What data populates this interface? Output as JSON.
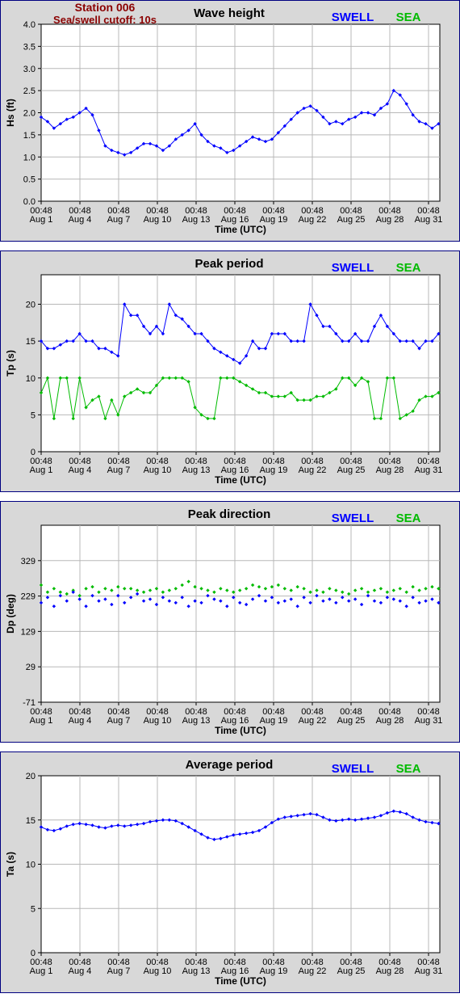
{
  "station": {
    "name": "Station 006",
    "cutoff": "Sea/swell cutoff: 10s"
  },
  "legend": {
    "swell": "SWELL",
    "sea": "SEA"
  },
  "colors": {
    "swell": "#0000ff",
    "sea": "#00bb00",
    "panel_bg": "#d8d8d8",
    "border": "#000080",
    "station": "#8b0000"
  },
  "x_ticks": {
    "time": [
      "00:48",
      "00:48",
      "00:48",
      "00:48",
      "00:48",
      "00:48",
      "00:48",
      "00:48",
      "00:48",
      "00:48",
      "00:48"
    ],
    "date": [
      "Aug 1",
      "Aug 4",
      "Aug 7",
      "Aug 10",
      "Aug 13",
      "Aug 16",
      "Aug 19",
      "Aug 22",
      "Aug 25",
      "Aug 28",
      "Aug 31"
    ]
  },
  "chart_data": [
    {
      "type": "line",
      "title": "Wave height",
      "xlabel": "Time (UTC)",
      "ylabel": "Hs (ft)",
      "ylim": [
        0,
        4
      ],
      "yticks": [
        "0.0",
        "0.5",
        "1.0",
        "1.5",
        "2.0",
        "2.5",
        "3.0",
        "3.5",
        "4.0"
      ],
      "xlim": [
        1,
        32.1
      ],
      "grid": true,
      "series": [
        {
          "name": "SWELL",
          "color": "#0000ff",
          "x": [
            1.0,
            1.5,
            2.0,
            2.5,
            3.0,
            3.5,
            4.0,
            4.5,
            5.0,
            5.5,
            6.0,
            6.5,
            7.0,
            7.5,
            8.0,
            8.5,
            9.0,
            9.5,
            10.0,
            10.5,
            11.0,
            11.5,
            12.0,
            12.5,
            13.0,
            13.5,
            14.0,
            14.5,
            15.0,
            15.5,
            16.0,
            16.5,
            17.0,
            17.5,
            18.0,
            18.5,
            19.0,
            19.5,
            20.0,
            20.5,
            21.0,
            21.5,
            22.0,
            22.5,
            23.0,
            23.5,
            24.0,
            24.5,
            25.0,
            25.5,
            26.0,
            26.5,
            27.0,
            27.5,
            28.0,
            28.5,
            29.0,
            29.5,
            30.0,
            30.5,
            31.0,
            31.5,
            32.0
          ],
          "y": [
            1.9,
            1.8,
            1.65,
            1.75,
            1.85,
            1.9,
            2.0,
            2.1,
            1.95,
            1.6,
            1.25,
            1.15,
            1.1,
            1.05,
            1.1,
            1.2,
            1.3,
            1.3,
            1.25,
            1.15,
            1.25,
            1.4,
            1.5,
            1.6,
            1.75,
            1.5,
            1.35,
            1.25,
            1.2,
            1.1,
            1.15,
            1.25,
            1.35,
            1.45,
            1.4,
            1.35,
            1.4,
            1.55,
            1.7,
            1.85,
            2.0,
            2.1,
            2.15,
            2.05,
            1.9,
            1.75,
            1.8,
            1.75,
            1.85,
            1.9,
            2.0,
            2.0,
            1.95,
            2.1,
            2.2,
            2.5,
            2.4,
            2.2,
            1.95,
            1.8,
            1.75,
            1.65,
            1.75
          ]
        },
        {
          "name": "SEA",
          "color": "#00bb00",
          "x": [],
          "y": []
        }
      ]
    },
    {
      "type": "line",
      "title": "Peak period",
      "xlabel": "Time (UTC)",
      "ylabel": "Tp (s)",
      "ylim": [
        0,
        24
      ],
      "yticks": [
        "0",
        "5",
        "10",
        "15",
        "20"
      ],
      "xlim": [
        1,
        32.1
      ],
      "grid": true,
      "series": [
        {
          "name": "SWELL",
          "color": "#0000ff",
          "x": [
            1.0,
            1.5,
            2.0,
            2.5,
            3.0,
            3.5,
            4.0,
            4.5,
            5.0,
            5.5,
            6.0,
            6.5,
            7.0,
            7.5,
            8.0,
            8.5,
            9.0,
            9.5,
            10.0,
            10.5,
            11.0,
            11.5,
            12.0,
            12.5,
            13.0,
            13.5,
            14.0,
            14.5,
            15.0,
            15.5,
            16.0,
            16.5,
            17.0,
            17.5,
            18.0,
            18.5,
            19.0,
            19.5,
            20.0,
            20.5,
            21.0,
            21.5,
            22.0,
            22.5,
            23.0,
            23.5,
            24.0,
            24.5,
            25.0,
            25.5,
            26.0,
            26.5,
            27.0,
            27.5,
            28.0,
            28.5,
            29.0,
            29.5,
            30.0,
            30.5,
            31.0,
            31.5,
            32.0
          ],
          "y": [
            15,
            14,
            14,
            14.5,
            15,
            15,
            16,
            15,
            15,
            14,
            14,
            13.5,
            13,
            20,
            18.5,
            18.5,
            17,
            16,
            17,
            16,
            20,
            18.5,
            18,
            17,
            16,
            16,
            15,
            14,
            13.5,
            13,
            12.5,
            12,
            13,
            15,
            14,
            14,
            16,
            16,
            16,
            15,
            15,
            15,
            20,
            18.5,
            17,
            17,
            16,
            15,
            15,
            16,
            15,
            15,
            17,
            18.5,
            17,
            16,
            15,
            15,
            15,
            14,
            15,
            15,
            16
          ]
        },
        {
          "name": "SEA",
          "color": "#00bb00",
          "x": [
            1.0,
            1.5,
            2.0,
            2.5,
            3.0,
            3.5,
            4.0,
            4.5,
            5.0,
            5.5,
            6.0,
            6.5,
            7.0,
            7.5,
            8.0,
            8.5,
            9.0,
            9.5,
            10.0,
            10.5,
            11.0,
            11.5,
            12.0,
            12.5,
            13.0,
            13.5,
            14.0,
            14.5,
            15.0,
            15.5,
            16.0,
            16.5,
            17.0,
            17.5,
            18.0,
            18.5,
            19.0,
            19.5,
            20.0,
            20.5,
            21.0,
            21.5,
            22.0,
            22.5,
            23.0,
            23.5,
            24.0,
            24.5,
            25.0,
            25.5,
            26.0,
            26.5,
            27.0,
            27.5,
            28.0,
            28.5,
            29.0,
            29.5,
            30.0,
            30.5,
            31.0,
            31.5,
            32.0
          ],
          "y": [
            8,
            10,
            4.5,
            10,
            10,
            4.5,
            10,
            6,
            7,
            7.5,
            4.5,
            7,
            5,
            7.5,
            8,
            8.5,
            8,
            8,
            9,
            10,
            10,
            10,
            10,
            9.5,
            6,
            5,
            4.5,
            4.5,
            10,
            10,
            10,
            9.5,
            9,
            8.5,
            8,
            8,
            7.5,
            7.5,
            7.5,
            8,
            7,
            7,
            7,
            7.5,
            7.5,
            8,
            8.5,
            10,
            10,
            9,
            10,
            9.5,
            4.5,
            4.5,
            10,
            10,
            4.5,
            5,
            5.5,
            7,
            7.5,
            7.5,
            8
          ]
        }
      ]
    },
    {
      "type": "scatter",
      "title": "Peak direction",
      "xlabel": "Time (UTC)",
      "ylabel": "Dp (deg)",
      "ylim": [
        -71,
        429
      ],
      "yticks": [
        "-71",
        "29",
        "129",
        "229",
        "329"
      ],
      "xlim": [
        1,
        32.1
      ],
      "grid": true,
      "series": [
        {
          "name": "SWELL",
          "color": "#0000ff",
          "x": [
            1.0,
            1.5,
            2.0,
            2.5,
            3.0,
            3.5,
            4.0,
            4.5,
            5.0,
            5.5,
            6.0,
            6.5,
            7.0,
            7.5,
            8.0,
            8.5,
            9.0,
            9.5,
            10.0,
            10.5,
            11.0,
            11.5,
            12.0,
            12.5,
            13.0,
            13.5,
            14.0,
            14.5,
            15.0,
            15.5,
            16.0,
            16.5,
            17.0,
            17.5,
            18.0,
            18.5,
            19.0,
            19.5,
            20.0,
            20.5,
            21.0,
            21.5,
            22.0,
            22.5,
            23.0,
            23.5,
            24.0,
            24.5,
            25.0,
            25.5,
            26.0,
            26.5,
            27.0,
            27.5,
            28.0,
            28.5,
            29.0,
            29.5,
            30.0,
            30.5,
            31.0,
            31.5,
            32.0
          ],
          "y": [
            210,
            225,
            200,
            230,
            215,
            240,
            220,
            200,
            230,
            215,
            220,
            205,
            230,
            210,
            225,
            235,
            215,
            220,
            205,
            225,
            215,
            210,
            225,
            200,
            215,
            210,
            230,
            220,
            215,
            200,
            225,
            210,
            205,
            220,
            230,
            215,
            225,
            210,
            215,
            220,
            200,
            225,
            210,
            230,
            215,
            220,
            210,
            225,
            215,
            220,
            205,
            230,
            215,
            210,
            225,
            220,
            215,
            200,
            225,
            210,
            215,
            220,
            210
          ]
        },
        {
          "name": "SEA",
          "color": "#00bb00",
          "x": [
            1.0,
            1.5,
            2.0,
            2.5,
            3.0,
            3.5,
            4.0,
            4.5,
            5.0,
            5.5,
            6.0,
            6.5,
            7.0,
            7.5,
            8.0,
            8.5,
            9.0,
            9.5,
            10.0,
            10.5,
            11.0,
            11.5,
            12.0,
            12.5,
            13.0,
            13.5,
            14.0,
            14.5,
            15.0,
            15.5,
            16.0,
            16.5,
            17.0,
            17.5,
            18.0,
            18.5,
            19.0,
            19.5,
            20.0,
            20.5,
            21.0,
            21.5,
            22.0,
            22.5,
            23.0,
            23.5,
            24.0,
            24.5,
            25.0,
            25.5,
            26.0,
            26.5,
            27.0,
            27.5,
            28.0,
            28.5,
            29.0,
            29.5,
            30.0,
            30.5,
            31.0,
            31.5,
            32.0
          ],
          "y": [
            260,
            240,
            250,
            240,
            235,
            245,
            230,
            250,
            255,
            240,
            250,
            245,
            255,
            250,
            250,
            245,
            240,
            245,
            250,
            240,
            245,
            250,
            260,
            270,
            255,
            250,
            245,
            240,
            250,
            245,
            240,
            245,
            250,
            260,
            255,
            250,
            255,
            260,
            250,
            245,
            255,
            250,
            240,
            245,
            240,
            250,
            245,
            240,
            235,
            245,
            250,
            240,
            245,
            250,
            240,
            245,
            250,
            240,
            255,
            245,
            250,
            255,
            250
          ]
        }
      ]
    },
    {
      "type": "line",
      "title": "Average period",
      "xlabel": "Time (UTC)",
      "ylabel": "Ta (s)",
      "ylim": [
        0,
        20
      ],
      "yticks": [
        "0",
        "5",
        "10",
        "15",
        "20"
      ],
      "xlim": [
        1,
        32.1
      ],
      "grid": true,
      "series": [
        {
          "name": "SWELL",
          "color": "#0000ff",
          "x": [
            1.0,
            1.5,
            2.0,
            2.5,
            3.0,
            3.5,
            4.0,
            4.5,
            5.0,
            5.5,
            6.0,
            6.5,
            7.0,
            7.5,
            8.0,
            8.5,
            9.0,
            9.5,
            10.0,
            10.5,
            11.0,
            11.5,
            12.0,
            12.5,
            13.0,
            13.5,
            14.0,
            14.5,
            15.0,
            15.5,
            16.0,
            16.5,
            17.0,
            17.5,
            18.0,
            18.5,
            19.0,
            19.5,
            20.0,
            20.5,
            21.0,
            21.5,
            22.0,
            22.5,
            23.0,
            23.5,
            24.0,
            24.5,
            25.0,
            25.5,
            26.0,
            26.5,
            27.0,
            27.5,
            28.0,
            28.5,
            29.0,
            29.5,
            30.0,
            30.5,
            31.0,
            31.5,
            32.0
          ],
          "y": [
            14.2,
            13.9,
            13.8,
            14.0,
            14.3,
            14.5,
            14.6,
            14.5,
            14.4,
            14.2,
            14.1,
            14.3,
            14.4,
            14.3,
            14.4,
            14.5,
            14.6,
            14.8,
            14.9,
            15.0,
            15.0,
            14.9,
            14.6,
            14.2,
            13.8,
            13.4,
            13.0,
            12.8,
            12.9,
            13.1,
            13.3,
            13.4,
            13.5,
            13.6,
            13.8,
            14.2,
            14.7,
            15.1,
            15.3,
            15.4,
            15.5,
            15.6,
            15.7,
            15.6,
            15.3,
            15.0,
            14.9,
            15.0,
            15.1,
            15.0,
            15.1,
            15.2,
            15.3,
            15.5,
            15.8,
            16.0,
            15.9,
            15.7,
            15.3,
            15.0,
            14.8,
            14.7,
            14.6
          ]
        },
        {
          "name": "SEA",
          "color": "#00bb00",
          "x": [],
          "y": []
        }
      ]
    }
  ]
}
